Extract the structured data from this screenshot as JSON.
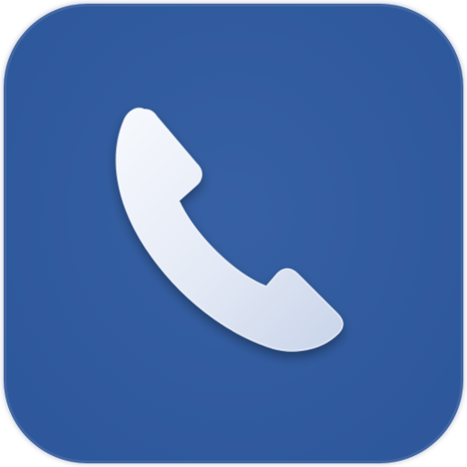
{
  "app_icon": {
    "icon": "phone-icon",
    "background_color": "#2e5aa0",
    "glyph_color": "#e9eef8"
  }
}
